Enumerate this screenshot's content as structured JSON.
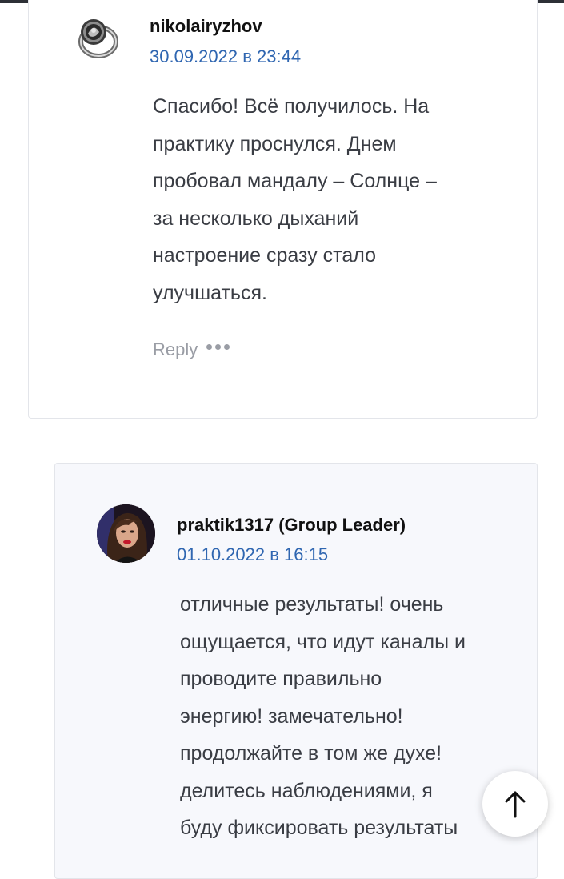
{
  "comments": [
    {
      "author": "nikolairyzhov",
      "date": "30.09.2022 в 23:44",
      "lines": [
        "Спасибо! Всё получилось. На",
        "практику проснулся. Днем",
        "пробовал мандалу – Солнце –",
        "за несколько дыханий",
        "настроение сразу стало",
        "улучшаться."
      ],
      "reply_label": "Reply",
      "avatar_icon": "ring-avatar-icon"
    },
    {
      "author": "praktik1317 (Group Leader)",
      "date": "01.10.2022 в 16:15",
      "lines": [
        "отличные результаты! очень",
        "ощущается, что идут каналы и",
        "проводите правильно",
        "энергию! замечательно!",
        "продолжайте в том же духе!",
        "делитесь наблюдениями, я",
        "буду фиксировать результаты"
      ],
      "avatar_icon": "user-photo-avatar"
    }
  ],
  "scroll_top": {
    "icon": "arrow-up-icon"
  },
  "colors": {
    "link": "#2f66b1",
    "text": "#3a3d44",
    "muted": "#9a9da5",
    "nested_bg": "#f7f8fc"
  }
}
